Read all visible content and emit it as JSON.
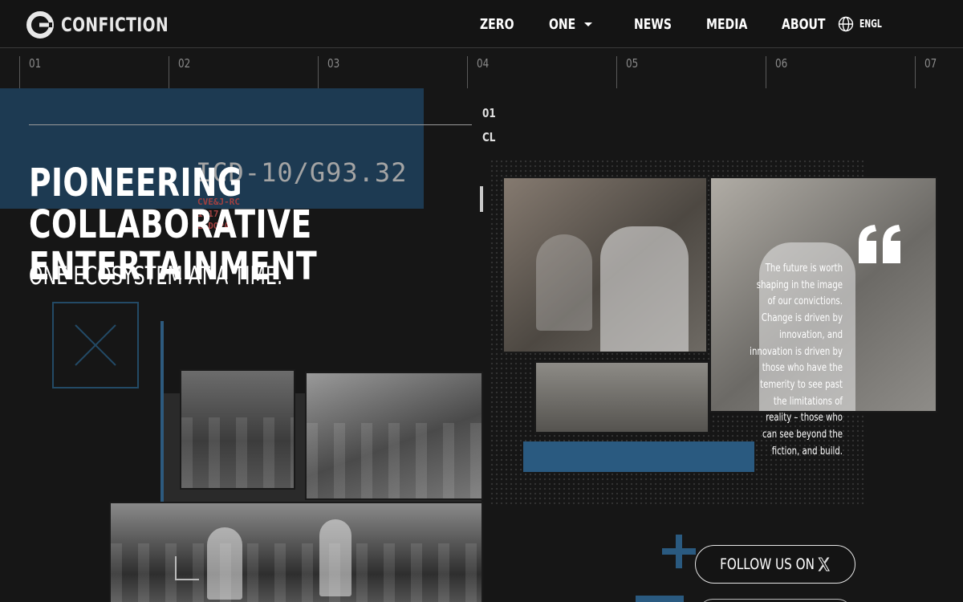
{
  "header": {
    "brand": "CONFICTION",
    "nav": [
      {
        "label": "ZERO"
      },
      {
        "label": "ONE"
      },
      {
        "label": "NEWS"
      },
      {
        "label": "MEDIA"
      },
      {
        "label": "ABOUT"
      }
    ],
    "language": "ENGL"
  },
  "timeline": {
    "ticks": [
      "01",
      "02",
      "03",
      "04",
      "05",
      "06",
      "07"
    ]
  },
  "slider": {
    "current": "01",
    "label": "CL"
  },
  "hero": {
    "title": "PIONEERING COLLABORATIVE ENTERTAINMENT",
    "subtitle": "ONE ECOSYSTEM AT A TIME.",
    "overlay_code": "ICD-10/G93.32",
    "red_lines": [
      "CVE&J-RC",
      "1917",
      "L-DOPA."
    ]
  },
  "quote": {
    "lines": [
      "The future is worth",
      "shaping in the image",
      "of our convictions.",
      "Change is driven by",
      "innovation, and",
      "innovation is driven by",
      "those who have the",
      "temerity to see past",
      "the limitations of",
      "reality – those who",
      "can see beyond the",
      "fiction, and build."
    ]
  },
  "social": {
    "follow_label": "FOLLOW US ON"
  },
  "colors": {
    "accent_blue": "#2a5a80",
    "background": "#161616",
    "text": "#ffffff"
  },
  "icons": [
    "confiction-logo-icon",
    "chevron-down-icon",
    "globe-icon",
    "quote-icon",
    "plus-icon",
    "x-logo-icon"
  ]
}
